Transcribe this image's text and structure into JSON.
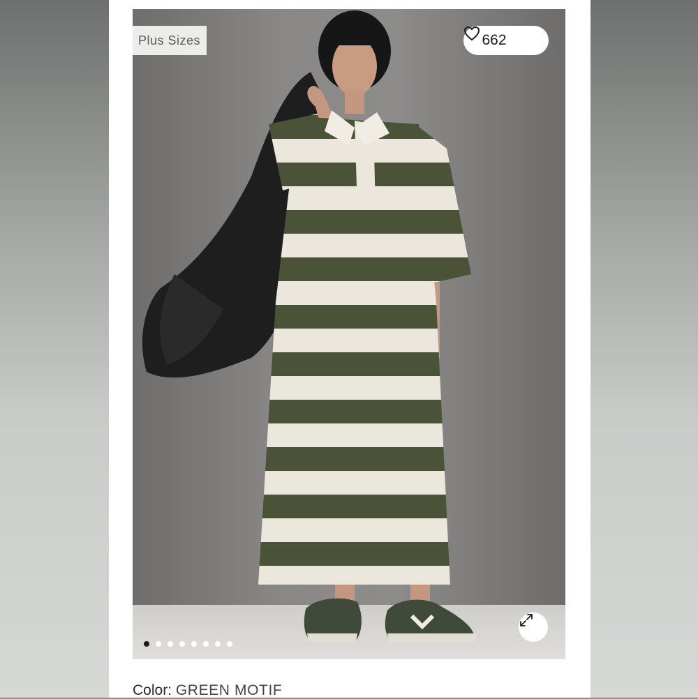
{
  "product": {
    "badge": "Plus Sizes",
    "like_count": "662",
    "carousel_slides": 8,
    "carousel_active_index": 0,
    "color_label": "Color:",
    "color_value": "GREEN MOTIF"
  },
  "icons": {
    "like": "heart-outline-icon",
    "expand": "expand-arrows-icon"
  },
  "colors": {
    "stripe_green": "#4a5338",
    "stripe_cream": "#ece7dc",
    "backdrop": "#8a8887",
    "card_bg": "#ffffff"
  }
}
